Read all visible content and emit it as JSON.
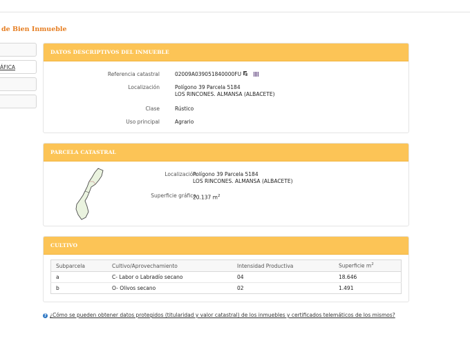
{
  "page": {
    "title": "de Bien Inmueble"
  },
  "sidebar": {
    "items": [
      {
        "label": ""
      },
      {
        "label": "ÁFICA"
      },
      {
        "label": ""
      },
      {
        "label": ""
      }
    ]
  },
  "descriptivos": {
    "heading": "DATOS DESCRIPTIVOS DEL INMUEBLE",
    "ref_label": "Referencia catastral",
    "ref_value": "02009A039051840000FU",
    "loc_label": "Localización",
    "loc_line1": "Polígono 39 Parcela 5184",
    "loc_line2": "LOS RINCONES. ALMANSA (ALBACETE)",
    "clase_label": "Clase",
    "clase_value": "Rústico",
    "uso_label": "Uso principal",
    "uso_value": "Agrario"
  },
  "parcela": {
    "heading": "PARCELA CATASTRAL",
    "loc_label": "Localización",
    "loc_line1": "Polígono 39 Parcela 5184",
    "loc_line2": "LOS RINCONES. ALMANSA (ALBACETE)",
    "sup_label": "Superficie gráfica",
    "sup_value": "20.137 m",
    "sup_unit_sup": "2"
  },
  "cultivo": {
    "heading": "CULTIVO",
    "columns": [
      "Subparcela",
      "Cultivo/Aprovechamiento",
      "Intensidad Productiva",
      "Superficie m"
    ],
    "col_sup": "2",
    "rows": [
      {
        "subparcela": "a",
        "cultivo": "C- Labor o Labradío secano",
        "intensidad": "04",
        "superficie": "18.646"
      },
      {
        "subparcela": "b",
        "cultivo": "O- Olivos secano",
        "intensidad": "02",
        "superficie": "1.491"
      }
    ]
  },
  "help": {
    "text": "¿Cómo se pueden obtener datos protegidos (titularidad y valor catastral) de los inmuebles y certificados telemáticos de los mismos?"
  },
  "icons": {
    "copy": "copy-icon",
    "barcode": "barcode-icon",
    "help": "help-icon"
  },
  "colors": {
    "header": "#fcc456",
    "title": "#e67e22",
    "help_icon": "#2f78c4"
  }
}
